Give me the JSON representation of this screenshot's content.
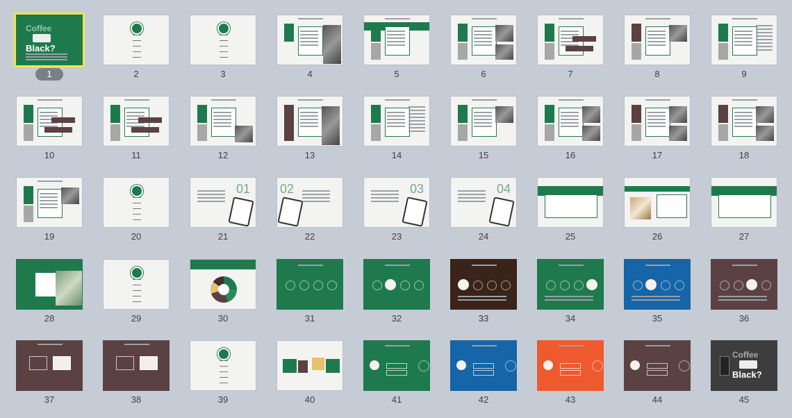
{
  "slides": [
    {
      "number": "1",
      "selected": true,
      "title_lines": [
        "Coffee",
        "Black?"
      ],
      "accent": "#1e7a4d"
    },
    {
      "number": "2"
    },
    {
      "number": "3"
    },
    {
      "number": "4"
    },
    {
      "number": "5"
    },
    {
      "number": "6"
    },
    {
      "number": "7"
    },
    {
      "number": "8"
    },
    {
      "number": "9"
    },
    {
      "number": "10"
    },
    {
      "number": "11"
    },
    {
      "number": "12"
    },
    {
      "number": "13"
    },
    {
      "number": "14"
    },
    {
      "number": "15"
    },
    {
      "number": "16"
    },
    {
      "number": "17"
    },
    {
      "number": "18"
    },
    {
      "number": "19"
    },
    {
      "number": "20"
    },
    {
      "number": "21",
      "big": "01"
    },
    {
      "number": "22",
      "big": "02"
    },
    {
      "number": "23",
      "big": "03"
    },
    {
      "number": "24",
      "big": "04"
    },
    {
      "number": "25"
    },
    {
      "number": "26"
    },
    {
      "number": "27"
    },
    {
      "number": "28"
    },
    {
      "number": "29"
    },
    {
      "number": "30"
    },
    {
      "number": "31"
    },
    {
      "number": "32"
    },
    {
      "number": "33"
    },
    {
      "number": "34"
    },
    {
      "number": "35"
    },
    {
      "number": "36"
    },
    {
      "number": "37"
    },
    {
      "number": "38"
    },
    {
      "number": "39"
    },
    {
      "number": "40"
    },
    {
      "number": "41"
    },
    {
      "number": "42"
    },
    {
      "number": "43"
    },
    {
      "number": "44"
    },
    {
      "number": "45",
      "title_lines": [
        "Coffee",
        "Black?"
      ]
    }
  ],
  "colors": {
    "background": "#c5ccd5",
    "green": "#1e7a4d",
    "brown": "#5b4142",
    "dark_brown": "#3a2318",
    "blue": "#1565a8",
    "orange": "#ee5a2e",
    "charcoal": "#3d3d3d",
    "selection": "#f1e54a"
  }
}
